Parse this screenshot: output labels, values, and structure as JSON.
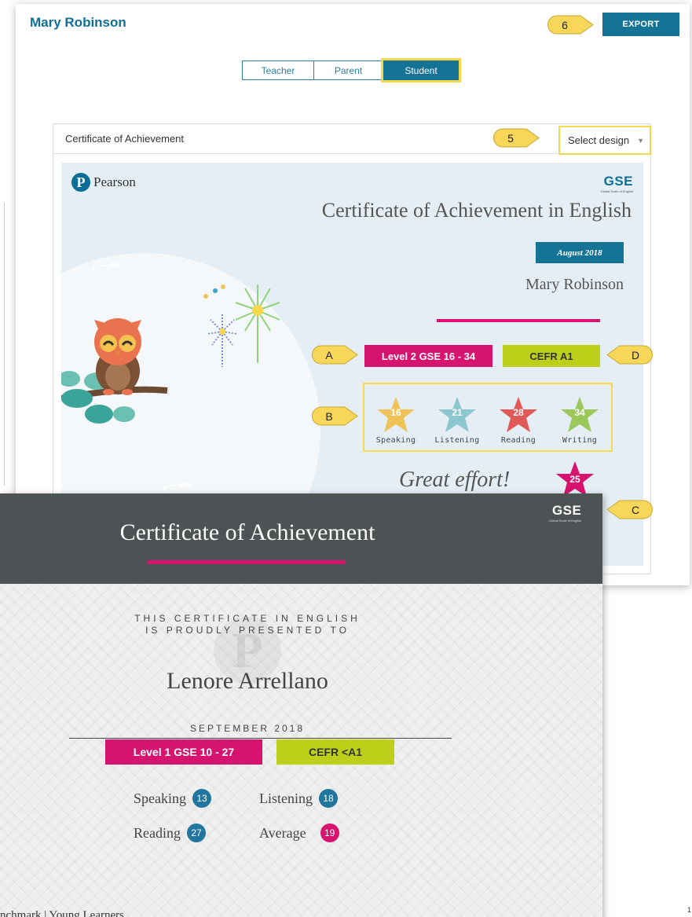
{
  "header": {
    "student_name": "Mary Robinson",
    "export_label": "EXPORT"
  },
  "tabs": [
    {
      "label": "Teacher",
      "selected": false
    },
    {
      "label": "Parent",
      "selected": false
    },
    {
      "label": "Student",
      "selected": true
    }
  ],
  "certificate_panel": {
    "title": "Certificate of Achievement",
    "select_design_label": "Select design"
  },
  "certificate_preview": {
    "brand": "Pearson",
    "gse_logo": "GSE",
    "gse_logo_sub": "Global Scale of English",
    "title": "Certificate of Achievement in English",
    "date": "August 2018",
    "student_name": "Mary Robinson",
    "level": "Level 2  GSE 16 - 34",
    "cefr": "CEFR A1",
    "skills": [
      {
        "label": "Speaking",
        "score": "16",
        "color": "#f0c35a"
      },
      {
        "label": "Listening",
        "score": "21",
        "color": "#8cc6cf"
      },
      {
        "label": "Reading",
        "score": "28",
        "color": "#e25a57"
      },
      {
        "label": "Writing",
        "score": "34",
        "color": "#9ac85a"
      }
    ],
    "message": "Great effort!",
    "average_score": "25"
  },
  "second_certificate": {
    "title": "Certificate of Achievement",
    "gse_logo": "GSE",
    "gse_logo_sub": "Global Scale of English",
    "presented_line1": "THIS CERTIFICATE IN ENGLISH",
    "presented_line2": "IS PROUDLY PRESENTED TO",
    "student_name": "Lenore Arrellano",
    "date": "SEPTEMBER 2018",
    "level": "Level 1  GSE 10 - 27",
    "cefr": "CEFR <A1",
    "scores": [
      {
        "label": "Speaking",
        "value": "13",
        "color": "#2176a0"
      },
      {
        "label": "Listening",
        "value": "18",
        "color": "#2176a0"
      },
      {
        "label": "Reading",
        "value": "27",
        "color": "#2176a0"
      },
      {
        "label": "Average",
        "value": "19",
        "color": "#d6136f"
      }
    ],
    "footer": "nchmark | Young Learners"
  },
  "callouts": {
    "export": "6",
    "select_design": "5",
    "level_badge": "A",
    "skills": "B",
    "second_certificate": "C",
    "cefr_badge": "D"
  },
  "colors": {
    "primary": "#157396",
    "magenta": "#d6136f",
    "lime": "#bcd01a",
    "callout": "#f8d65a",
    "highlight": "#f5d84c"
  },
  "page_number": "1"
}
